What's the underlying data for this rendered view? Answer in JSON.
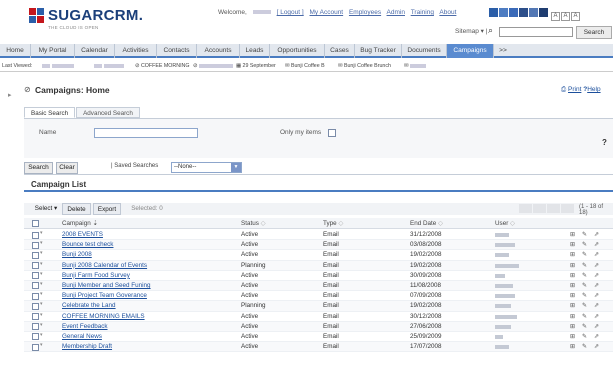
{
  "header": {
    "brand": "SUGARCRM.",
    "tagline": "THE CLOUD IS OPEN",
    "welcome": "Welcome,",
    "logout": "[ Logout ]",
    "links": [
      "My Account",
      "Employees",
      "Admin",
      "Training",
      "About"
    ],
    "sitemap": "Sitemap",
    "search_button": "Search",
    "search_placeholder": "",
    "swatch_colors": [
      "#2b5ea8",
      "#4d7cc2",
      "#3a6ab8",
      "#2c4f8a",
      "#5277b4",
      "#1f3d70"
    ],
    "font_sizes": [
      "A",
      "A",
      "A"
    ]
  },
  "tabs": [
    {
      "label": "Home"
    },
    {
      "label": "My Portal"
    },
    {
      "label": "Calendar"
    },
    {
      "label": "Activities"
    },
    {
      "label": "Contacts"
    },
    {
      "label": "Accounts"
    },
    {
      "label": "Leads"
    },
    {
      "label": "Opportunities"
    },
    {
      "label": "Cases"
    },
    {
      "label": "Bug Tracker"
    },
    {
      "label": "Documents"
    },
    {
      "label": "Campaigns"
    },
    {
      "label": ">>"
    }
  ],
  "active_tab": "Campaigns",
  "last_viewed": {
    "label": "Last Viewed:",
    "items": [
      "COFFEE MORNING",
      "29 September",
      "Bunji Coffee B",
      "Bunji Coffee Brunch"
    ]
  },
  "page": {
    "title": "Campaigns: Home",
    "print": "Print",
    "help": "Help"
  },
  "search": {
    "tab_basic": "Basic Search",
    "tab_advanced": "Advanced Search",
    "name_label": "Name",
    "only_my_items": "Only my items",
    "help_mark": "?",
    "search_button": "Search",
    "clear_button": "Clear",
    "saved_searches_label": "Saved Searches",
    "saved_searches_value": "--None--"
  },
  "list": {
    "title": "Campaign List",
    "select_label": "Select",
    "delete": "Delete",
    "export": "Export",
    "selected": "Selected: 0",
    "pagination": "(1 - 18 of 18)",
    "columns": [
      "Campaign",
      "Status",
      "Type",
      "End Date",
      "User"
    ],
    "rows": [
      {
        "name": "2008 EVENTS",
        "status": "Active",
        "type": "Email",
        "end_date": "31/12/2008"
      },
      {
        "name": "Bounce test check",
        "status": "Active",
        "type": "Email",
        "end_date": "03/08/2008"
      },
      {
        "name": "Bunji 2008",
        "status": "Active",
        "type": "Email",
        "end_date": "19/02/2008"
      },
      {
        "name": "Bunji 2008 Calendar of Events",
        "status": "Planning",
        "type": "Email",
        "end_date": "19/02/2008"
      },
      {
        "name": "Bunji Farm Food Survey",
        "status": "Active",
        "type": "Email",
        "end_date": "30/09/2008"
      },
      {
        "name": "Bunji Member and Seed Funing",
        "status": "Active",
        "type": "Email",
        "end_date": "11/08/2008"
      },
      {
        "name": "Bunji Project Team Goverance",
        "status": "Active",
        "type": "Email",
        "end_date": "07/09/2008"
      },
      {
        "name": "Celebrate the Land",
        "status": "Planning",
        "type": "Email",
        "end_date": "19/02/2008"
      },
      {
        "name": "COFFEE MORNING EMAILS",
        "status": "Active",
        "type": "Email",
        "end_date": "30/12/2008"
      },
      {
        "name": "Event Feedback",
        "status": "Active",
        "type": "Email",
        "end_date": "27/06/2008"
      },
      {
        "name": "General News",
        "status": "Active",
        "type": "Email",
        "end_date": "25/09/2009"
      },
      {
        "name": "Membership Draft",
        "status": "Active",
        "type": "Email",
        "end_date": "17/07/2008"
      }
    ]
  }
}
